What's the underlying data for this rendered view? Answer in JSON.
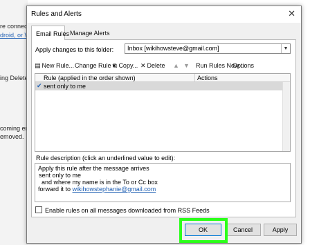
{
  "background": {
    "lines": [
      {
        "text": "re connect",
        "link": false
      },
      {
        "text": "droid, or W",
        "link": true
      },
      {
        "text": "ing Deleted I",
        "link": false
      },
      {
        "text": "coming em",
        "link": false
      },
      {
        "text": "emoved.",
        "link": false
      }
    ]
  },
  "dialog": {
    "title": "Rules and Alerts",
    "close_glyph": "✕",
    "tabs": [
      {
        "label": "Email Rules",
        "active": true
      },
      {
        "label": "Manage Alerts",
        "active": false
      }
    ],
    "folder_label": "Apply changes to this folder:",
    "folder_value": "Inbox [wikihowsteve@gmail.com]",
    "toolbar": {
      "new_rule": "New Rule...",
      "change_rule": "Change Rule",
      "copy": "Copy...",
      "delete": "Delete",
      "run_rules_now": "Run Rules Now...",
      "options": "Options"
    },
    "grid": {
      "col_rule": "Rule (applied in the order shown)",
      "col_actions": "Actions",
      "rows": [
        {
          "name": "sent only to me",
          "checked": true,
          "action_icon": "rule-actions-icon"
        }
      ]
    },
    "description_label": "Rule description (click an underlined value to edit):",
    "description": {
      "line1": "Apply this rule after the message arrives",
      "line2": "sent only to me",
      "line3": "  and where my name is in the To or Cc box",
      "line4_prefix": "forward it to ",
      "line4_link": "wikihowstephanie@gmail.com"
    },
    "rss_label": "Enable rules on all messages downloaded from RSS Feeds",
    "buttons": {
      "ok": "OK",
      "cancel": "Cancel",
      "apply": "Apply"
    }
  },
  "colors": {
    "highlight": "#2bff1a",
    "link": "#1f5fb3",
    "ok_border": "#0078d7"
  }
}
